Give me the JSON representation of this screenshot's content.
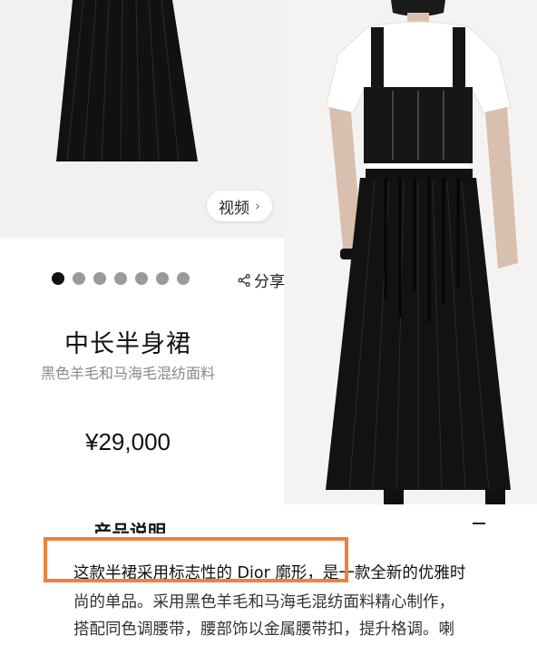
{
  "gallery": {
    "video_label": "视频",
    "video_chevron": "›",
    "dot_count": 7,
    "active_dot": 1,
    "share_label": "分享"
  },
  "product": {
    "title": "中长半身裙",
    "subtitle": "黑色羊毛和马海毛混纺面料",
    "price": "¥29,000"
  },
  "description": {
    "heading": "产品说明",
    "collapse_icon": "minus-icon",
    "line1": "这款半裙采用标志性的 Dior 廓形，是一款全新的优雅时",
    "line2": "尚的单品。采用黑色羊毛和马海毛混纺面料精心制作，",
    "line3": "搭配同色调腰带，腰部饰以金属腰带扣，提升格调。喇"
  },
  "colors": {
    "highlight": "#f0803c",
    "active_dot": "#111111",
    "inactive_dot": "#9a9a9a"
  }
}
